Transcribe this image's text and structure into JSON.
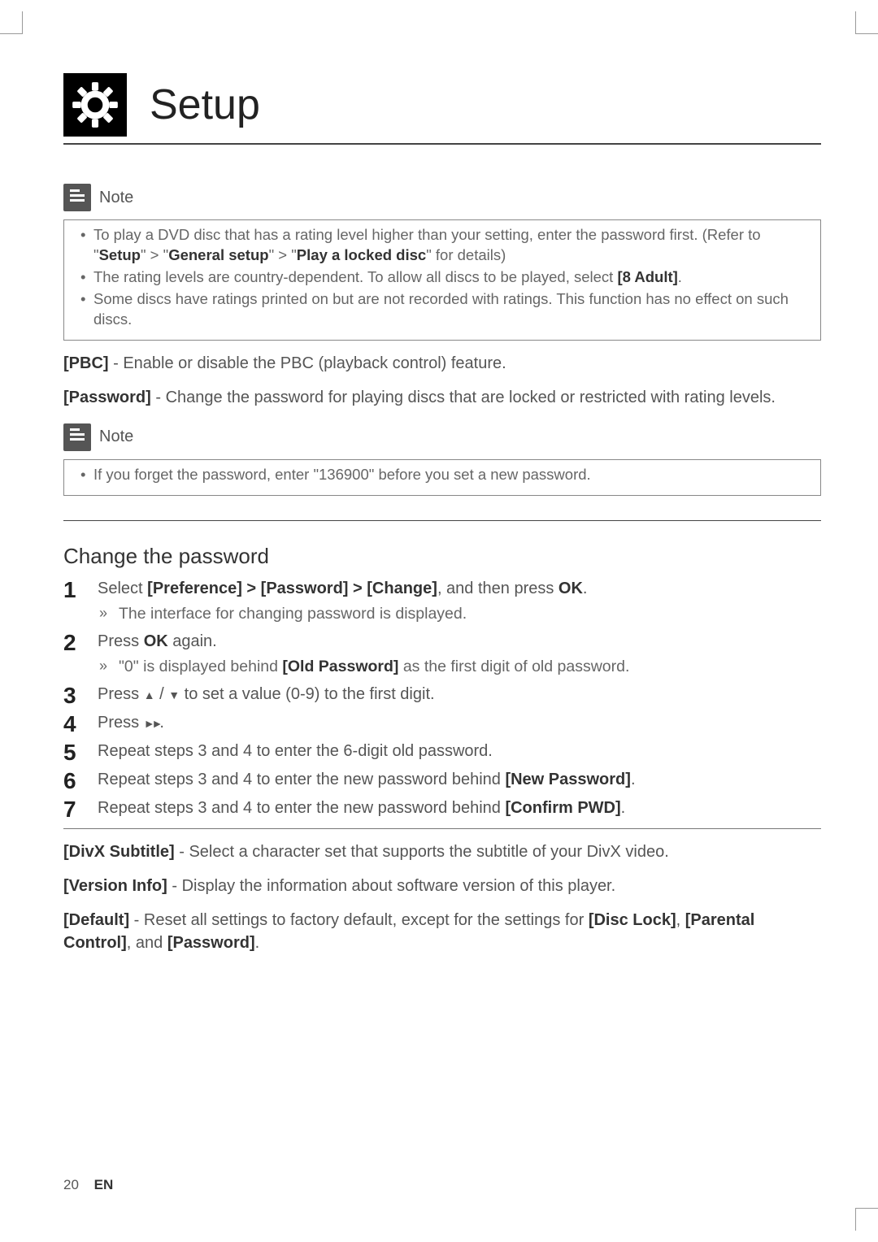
{
  "header": {
    "title": "Setup"
  },
  "note1": {
    "label": "Note",
    "items": [
      {
        "pre": "To play a DVD disc that has a rating level higher than your setting, enter the password first. (Refer to \"",
        "b1": "Setup",
        "mid1": "\" > \"",
        "b2": "General setup",
        "mid2": "\" > \"",
        "b3": "Play a locked disc",
        "post": "\" for details)"
      },
      {
        "pre": "The rating levels are country-dependent. To allow all discs to be played, select ",
        "b1": "[8 Adult]",
        "post": "."
      },
      {
        "pre": "Some discs have ratings printed on but are not recorded with ratings. This function has no effect on such discs."
      }
    ]
  },
  "para_pbc": {
    "b": "[PBC]",
    "t": " - Enable or disable the PBC (playback control) feature."
  },
  "para_pwd": {
    "b": "[Password]",
    "t": " - Change the password for playing discs that are locked or restricted with rating levels."
  },
  "note2": {
    "label": "Note",
    "items": [
      {
        "pre": "If you forget the password, enter \"136900\" before you set a new password."
      }
    ]
  },
  "section": {
    "title": "Change the password"
  },
  "steps": {
    "s1_a": "Select ",
    "s1_b": "[Preference] > [Password] > [Change]",
    "s1_c": ", and then press ",
    "s1_d": "OK",
    "s1_e": ".",
    "s1_sub": "The interface for changing password is displayed.",
    "s2_a": "Press ",
    "s2_b": "OK",
    "s2_c": " again.",
    "s2_sub_a": "\"0\" is displayed behind ",
    "s2_sub_b": "[Old Password]",
    "s2_sub_c": " as the first digit of old password.",
    "s3_a": "Press ",
    "s3_b": " / ",
    "s3_c": " to set a value (0-9) to the first digit.",
    "s4_a": "Press ",
    "s4_b": ".",
    "s5": "Repeat steps 3 and 4 to enter the 6-digit old password.",
    "s6_a": "Repeat steps 3 and 4 to enter the new password behind ",
    "s6_b": "[New Password]",
    "s6_c": ".",
    "s7_a": "Repeat steps 3 and 4 to enter the new password behind ",
    "s7_b": "[Confirm PWD]",
    "s7_c": "."
  },
  "para_divx": {
    "b": "[DivX Subtitle]",
    "t": " - Select a character set that supports the subtitle of your DivX video."
  },
  "para_ver": {
    "b": "[Version Info]",
    "t": " - Display the information about software version of this player."
  },
  "para_def": {
    "b": "[Default]",
    "t1": " - Reset all settings to factory default, except for the settings for ",
    "b2": "[Disc Lock]",
    "t2": ", ",
    "b3": "[Parental Control]",
    "t3": ", and ",
    "b4": "[Password]",
    "t4": "."
  },
  "footer": {
    "page": "20",
    "lang": "EN"
  }
}
